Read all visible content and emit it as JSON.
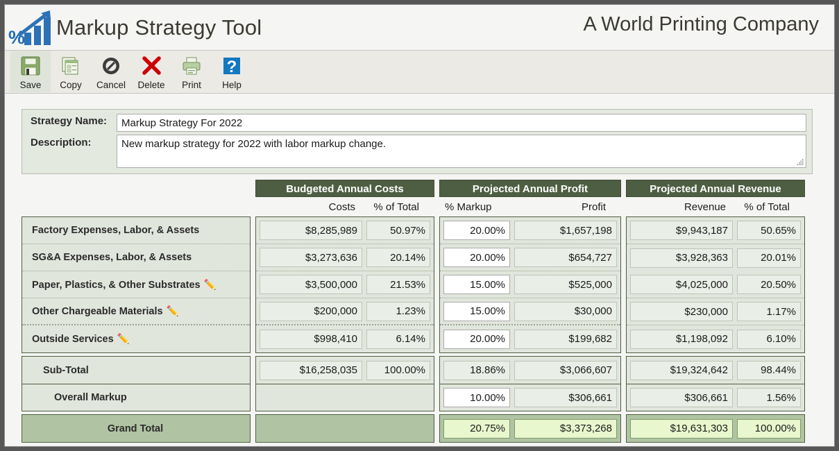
{
  "header": {
    "app_title": "Markup Strategy Tool",
    "company": "A World Printing Company",
    "logo_icon": "percent-bar-chart-growth-icon"
  },
  "toolbar": {
    "buttons": [
      {
        "label": "Save",
        "icon": "floppy-disk-save-icon",
        "selected": true
      },
      {
        "label": "Copy",
        "icon": "copy-documents-icon",
        "selected": false
      },
      {
        "label": "Cancel",
        "icon": "no-entry-cancel-icon",
        "selected": false
      },
      {
        "label": "Delete",
        "icon": "red-x-delete-icon",
        "selected": false
      },
      {
        "label": "Print",
        "icon": "printer-icon",
        "selected": false
      },
      {
        "label": "Help",
        "icon": "question-mark-help-icon",
        "selected": false
      }
    ]
  },
  "form": {
    "strategy_name_label": "Strategy Name:",
    "strategy_name_value": "Markup Strategy For 2022",
    "strategy_name_placeholder": "",
    "description_label": "Description:",
    "description_value": "New markup strategy for 2022 with labor markup change.",
    "description_placeholder": ""
  },
  "grid": {
    "group_headers": {
      "costs": "Budgeted Annual Costs",
      "profit": "Projected Annual Profit",
      "revenue": "Projected Annual Revenue"
    },
    "column_headers": {
      "costs": "Costs",
      "costs_pct": "% of Total",
      "markup": "% Markup",
      "profit": "Profit",
      "revenue": "Revenue",
      "revenue_pct": "% of Total"
    },
    "rows": [
      {
        "label": "Factory Expenses, Labor, & Assets",
        "editable_label": false,
        "costs": "$8,285,989",
        "costs_pct": "50.97%",
        "markup": "20.00%",
        "profit": "$1,657,198",
        "revenue": "$9,943,187",
        "revenue_pct": "50.65%"
      },
      {
        "label": "SG&A Expenses, Labor, & Assets",
        "editable_label": false,
        "costs": "$3,273,636",
        "costs_pct": "20.14%",
        "markup": "20.00%",
        "profit": "$654,727",
        "revenue": "$3,928,363",
        "revenue_pct": "20.01%"
      },
      {
        "label": "Paper, Plastics, & Other Substrates",
        "editable_label": true,
        "costs": "$3,500,000",
        "costs_pct": "21.53%",
        "markup": "15.00%",
        "profit": "$525,000",
        "revenue": "$4,025,000",
        "revenue_pct": "20.50%"
      },
      {
        "label": "Other Chargeable Materials",
        "editable_label": true,
        "costs": "$200,000",
        "costs_pct": "1.23%",
        "markup": "15.00%",
        "profit": "$30,000",
        "revenue": "$230,000",
        "revenue_pct": "1.17%"
      },
      {
        "label": "Outside Services",
        "editable_label": true,
        "costs": "$998,410",
        "costs_pct": "6.14%",
        "markup": "20.00%",
        "profit": "$199,682",
        "revenue": "$1,198,092",
        "revenue_pct": "6.10%"
      }
    ],
    "subtotal": {
      "label": "Sub-Total",
      "costs": "$16,258,035",
      "costs_pct": "100.00%",
      "markup": "18.86%",
      "profit": "$3,066,607",
      "revenue": "$19,324,642",
      "revenue_pct": "98.44%"
    },
    "overall_markup": {
      "label": "Overall Markup",
      "costs": "",
      "costs_pct": "",
      "markup": "10.00%",
      "profit": "$306,661",
      "revenue": "$306,661",
      "revenue_pct": "1.56%"
    },
    "grand_total": {
      "label": "Grand Total",
      "costs": "",
      "costs_pct": "",
      "markup": "20.75%",
      "profit": "$3,373,268",
      "revenue": "$19,631,303",
      "revenue_pct": "100.00%"
    }
  },
  "colors": {
    "group_header_bg": "#4e5e42",
    "panel_bg": "#e1e6dc",
    "grand_total_bg": "#b0c4a3",
    "total_cell_bg": "#e8f7cd",
    "logo_blue": "#1f6cb0",
    "help_blue": "#1478be"
  }
}
